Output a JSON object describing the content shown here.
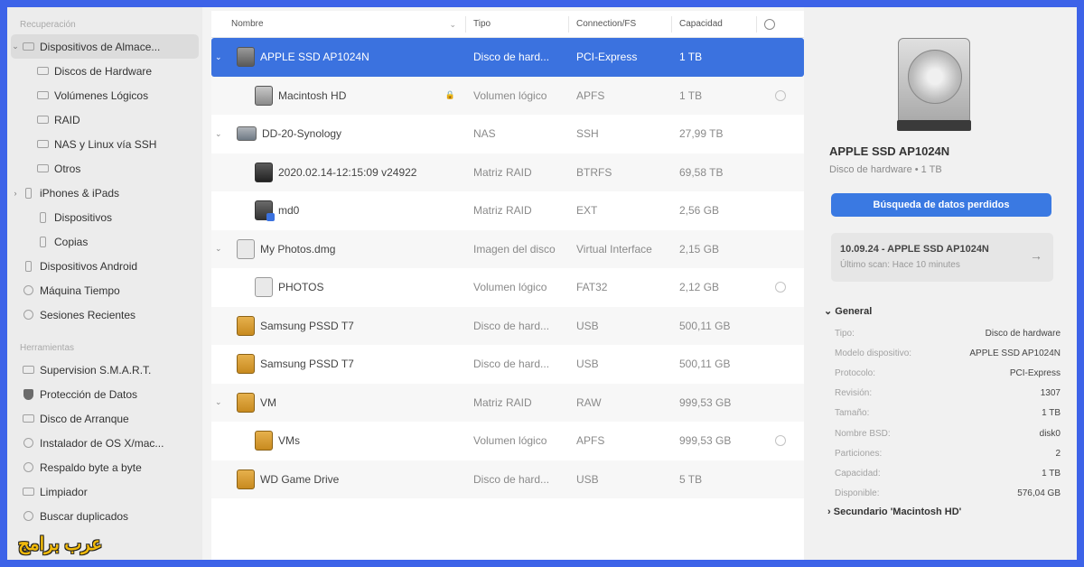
{
  "sidebar": {
    "section1": "Recuperación",
    "items1": [
      {
        "label": "Dispositivos de Almace...",
        "icon": "drive-icon",
        "chev": "⌄",
        "selected": true
      },
      {
        "label": "Discos de Hardware",
        "icon": "drive-icon"
      },
      {
        "label": "Volúmenes Lógicos",
        "icon": "drive-icon"
      },
      {
        "label": "RAID",
        "icon": "drive-icon"
      },
      {
        "label": "NAS y Linux vía SSH",
        "icon": "drive-icon"
      },
      {
        "label": "Otros",
        "icon": "drive-icon"
      },
      {
        "label": "iPhones & iPads",
        "icon": "phone-icon",
        "chev": "›"
      },
      {
        "label": "Dispositivos",
        "icon": "phone-icon"
      },
      {
        "label": "Copias",
        "icon": "phone-icon"
      },
      {
        "label": "Dispositivos Android",
        "icon": "phone-icon"
      },
      {
        "label": "Máquina Tiempo",
        "icon": "clock-icon"
      },
      {
        "label": "Sesiones Recientes",
        "icon": "gear-icon"
      }
    ],
    "section2": "Herramientas",
    "items2": [
      {
        "label": "Supervision S.M.A.R.T.",
        "icon": "smart-icon"
      },
      {
        "label": "Protección de Datos",
        "icon": "shield-icon"
      },
      {
        "label": "Disco de Arranque",
        "icon": "boot-disk-icon"
      },
      {
        "label": "Instalador de OS X/mac...",
        "icon": "installer-icon"
      },
      {
        "label": "Respaldo byte a byte",
        "icon": "backup-icon"
      },
      {
        "label": "Limpiador",
        "icon": "cleaner-icon"
      },
      {
        "label": "Buscar duplicados",
        "icon": "duplicates-icon"
      }
    ]
  },
  "watermark": "عرب برامج",
  "table": {
    "headers": {
      "name": "Nombre",
      "type": "Tipo",
      "conn": "Connection/FS",
      "cap": "Capacidad"
    },
    "rows": [
      {
        "name": "APPLE SSD AP1024N",
        "type": "Disco de hard...",
        "conn": "PCI-Express",
        "cap": "1 TB",
        "level": 0,
        "chev": "⌄",
        "icon": "d-hd",
        "selected": true
      },
      {
        "name": "Macintosh HD",
        "type": "Volumen lógico",
        "conn": "APFS",
        "cap": "1 TB",
        "level": 1,
        "icon": "d-hd light",
        "lock": true,
        "mount": true
      },
      {
        "name": "DD-20-Synology",
        "type": "NAS",
        "conn": "SSH",
        "cap": "27,99 TB",
        "level": 0,
        "chev": "⌄",
        "icon": "d-nas"
      },
      {
        "name": "2020.02.14-12:15:09 v24922",
        "type": "Matriz RAID",
        "conn": "BTRFS",
        "cap": "69,58 TB",
        "level": 1,
        "icon": "d-raid"
      },
      {
        "name": "md0",
        "type": "Matriz RAID",
        "conn": "EXT",
        "cap": "2,56 GB",
        "level": 1,
        "icon": "d-raid2"
      },
      {
        "name": "My Photos.dmg",
        "type": "Imagen del disco",
        "conn": "Virtual Interface",
        "cap": "2,15 GB",
        "level": 0,
        "chev": "⌄",
        "icon": "d-dmg"
      },
      {
        "name": "PHOTOS",
        "type": "Volumen lógico",
        "conn": "FAT32",
        "cap": "2,12 GB",
        "level": 1,
        "icon": "d-dmg",
        "mount": true
      },
      {
        "name": "Samsung PSSD T7",
        "type": "Disco de hard...",
        "conn": "USB",
        "cap": "500,11 GB",
        "level": 0,
        "icon": "d-ext"
      },
      {
        "name": "Samsung PSSD T7",
        "type": "Disco de hard...",
        "conn": "USB",
        "cap": "500,11 GB",
        "level": 0,
        "icon": "d-ext"
      },
      {
        "name": "VM",
        "type": "Matriz RAID",
        "conn": "RAW",
        "cap": "999,53 GB",
        "level": 0,
        "chev": "⌄",
        "icon": "d-ext"
      },
      {
        "name": "VMs",
        "type": "Volumen lógico",
        "conn": "APFS",
        "cap": "999,53 GB",
        "level": 1,
        "icon": "d-ext",
        "mount": true
      },
      {
        "name": "WD Game Drive",
        "type": "Disco de hard...",
        "conn": "USB",
        "cap": "5 TB",
        "level": 0,
        "icon": "d-ext"
      }
    ]
  },
  "detail": {
    "title": "APPLE SSD AP1024N",
    "subtitle": "Disco de hardware • 1 TB",
    "button": "Búsqueda de datos perdidos",
    "scan_title": "10.09.24 - APPLE SSD AP1024N",
    "scan_sub": "Último scan: Hace 10 minutes",
    "general": "General",
    "props": [
      {
        "k": "Tipo:",
        "v": "Disco de hardware"
      },
      {
        "k": "Modelo dispositivo:",
        "v": "APPLE SSD AP1024N"
      },
      {
        "k": "Protocolo:",
        "v": "PCI-Express"
      },
      {
        "k": "Revisión:",
        "v": "1307"
      },
      {
        "k": "Tamaño:",
        "v": "1 TB"
      },
      {
        "k": "Nombre BSD:",
        "v": "disk0"
      },
      {
        "k": "Particiones:",
        "v": "2"
      },
      {
        "k": "Capacidad:",
        "v": "1 TB"
      },
      {
        "k": "Disponible:",
        "v": "576,04 GB"
      }
    ],
    "secondary": "Secundario 'Macintosh HD'"
  }
}
